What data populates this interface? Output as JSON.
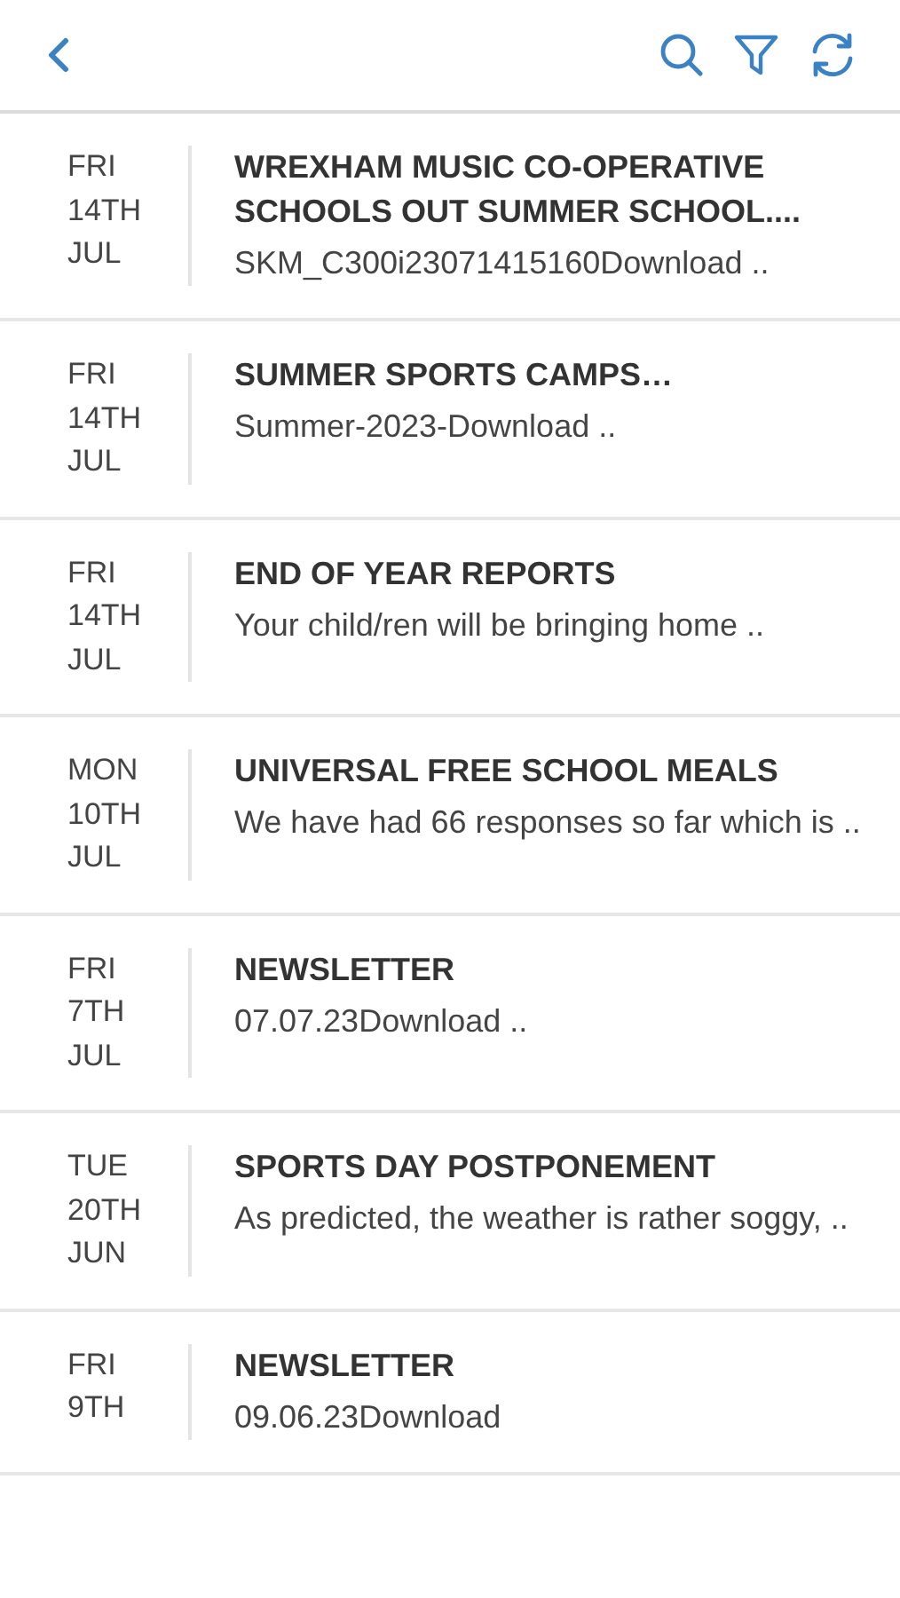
{
  "toolbar": {
    "buttons": [
      {
        "kind": "back"
      },
      {
        "kind": "search"
      },
      {
        "kind": "filter"
      },
      {
        "kind": "refresh"
      }
    ]
  },
  "items": [
    {
      "weekday": "FRI",
      "day": "14TH",
      "month": "JUL",
      "title": "WREXHAM MUSIC CO-OPERATIVE SCHOOLS OUT SUMMER SCHOOL....",
      "summary": "SKM_C300i23071415160Download .."
    },
    {
      "weekday": "FRI",
      "day": "14TH",
      "month": "JUL",
      "title": "SUMMER SPORTS CAMPS…",
      "summary": "Summer-2023-Download .."
    },
    {
      "weekday": "FRI",
      "day": "14TH",
      "month": "JUL",
      "title": "END OF YEAR REPORTS",
      "summary": "Your child/ren will be bringing home .."
    },
    {
      "weekday": "MON",
      "day": "10TH",
      "month": "JUL",
      "title": "UNIVERSAL FREE SCHOOL MEALS",
      "summary": "We have had 66 responses so far which is .."
    },
    {
      "weekday": "FRI",
      "day": "7TH",
      "month": "JUL",
      "title": "NEWSLETTER",
      "summary": "07.07.23Download .."
    },
    {
      "weekday": "TUE",
      "day": "20TH",
      "month": "JUN",
      "title": "SPORTS DAY POSTPONEMENT",
      "summary": "As predicted, the weather is rather soggy, .."
    },
    {
      "weekday": "FRI",
      "day": "9TH",
      "title": "NEWSLETTER",
      "summary": "09.06.23Download"
    }
  ]
}
